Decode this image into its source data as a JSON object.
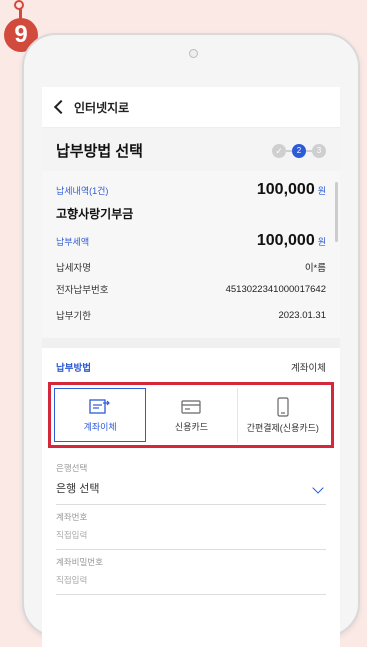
{
  "step_marker": {
    "number": "9"
  },
  "nav": {
    "title": "인터넷지로"
  },
  "header": {
    "title": "납부방법 선택",
    "steps": [
      "✓",
      "2",
      "3"
    ]
  },
  "summary": {
    "count_label": "납세내역(1건)",
    "total_amount": "100,000",
    "currency": "원",
    "item_name": "고향사랑기부금",
    "tax_label": "납부세액",
    "tax_amount": "100,000",
    "tax_currency": "원",
    "rows": [
      {
        "label": "납세자명",
        "value": "이*름"
      },
      {
        "label": "전자납부번호",
        "value": "4513022341000017642"
      },
      {
        "label": "납부기한",
        "value": "2023.01.31"
      }
    ]
  },
  "payment": {
    "label": "납부방법",
    "selected": "계좌이체",
    "tabs": [
      {
        "label": "계좌이체",
        "icon": "bank-transfer-icon",
        "active": true
      },
      {
        "label": "신용카드",
        "icon": "credit-card-icon",
        "active": false
      },
      {
        "label": "간편결제(신용카드)",
        "icon": "mobile-phone-icon",
        "active": false
      }
    ]
  },
  "form": {
    "bank_label": "은행선택",
    "bank_value": "은행 선택",
    "account_label": "계좌번호",
    "account_placeholder": "직접입력",
    "password_label": "계좌비밀번호",
    "password_placeholder": "직접입력"
  },
  "colors": {
    "accent": "#2d5bd7",
    "highlight": "#d4283a",
    "marker": "#d24a3c"
  }
}
